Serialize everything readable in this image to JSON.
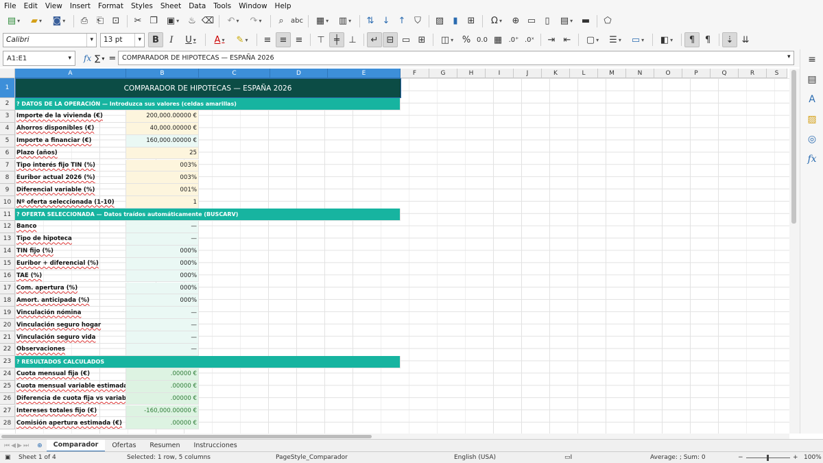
{
  "menu": [
    "File",
    "Edit",
    "View",
    "Insert",
    "Format",
    "Styles",
    "Sheet",
    "Data",
    "Tools",
    "Window",
    "Help"
  ],
  "font": {
    "name": "Calibri",
    "size": "13 pt"
  },
  "formula": {
    "cellref": "A1:E1",
    "content": "COMPARADOR DE HIPOTECAS — ESPAÑA 2026",
    "fx": "fx",
    "sum": "∑",
    "eq": "="
  },
  "columns": [
    "A",
    "B",
    "C",
    "D",
    "E",
    "F",
    "G",
    "H",
    "I",
    "J",
    "K",
    "L",
    "M",
    "N",
    "O",
    "P",
    "Q",
    "R",
    "S"
  ],
  "rows": [
    "1",
    "2",
    "3",
    "4",
    "5",
    "6",
    "7",
    "8",
    "9",
    "10",
    "11",
    "12",
    "13",
    "14",
    "15",
    "16",
    "17",
    "18",
    "19",
    "20",
    "21",
    "22",
    "23",
    "24",
    "25",
    "26",
    "27",
    "28"
  ],
  "sheet": {
    "title": "COMPARADOR DE HIPOTECAS — ESPAÑA 2026",
    "sec1": "? DATOS DE LA OPERACIÓN — Introduzca sus valores (celdas amarillas)",
    "sec2": "? OFERTA SELECCIONADA — Datos traídos automáticamente (BUSCARV)",
    "sec3": "? RESULTADOS CALCULADOS",
    "inputs": [
      {
        "label": "Importe de la vivienda (€)",
        "value": "200,000.00000 €"
      },
      {
        "label": "Ahorros disponibles (€)",
        "value": "40,000.00000 €"
      },
      {
        "label": "Importe a financiar (€)",
        "value": "160,000.00000 €"
      },
      {
        "label": "Plazo (años)",
        "value": "25"
      },
      {
        "label": "Tipo interés fijo TIN (%)",
        "value": "003%"
      },
      {
        "label": "Euribor actual 2026 (%)",
        "value": "003%"
      },
      {
        "label": "Diferencial variable (%)",
        "value": "001%"
      },
      {
        "label": "Nº oferta seleccionada (1-10)",
        "value": "1"
      }
    ],
    "offer": [
      {
        "label": "Banco",
        "value": "—"
      },
      {
        "label": "Tipo de hipoteca",
        "value": "—"
      },
      {
        "label": "TIN fijo (%)",
        "value": "000%"
      },
      {
        "label": "Euribor + diferencial (%)",
        "value": "000%"
      },
      {
        "label": "TAE (%)",
        "value": "000%"
      },
      {
        "label": "Com. apertura (%)",
        "value": "000%"
      },
      {
        "label": "Amort. anticipada (%)",
        "value": "000%"
      },
      {
        "label": "Vinculación nómina",
        "value": "—"
      },
      {
        "label": "Vinculación seguro hogar",
        "value": "—"
      },
      {
        "label": "Vinculación seguro vida",
        "value": "—"
      },
      {
        "label": "Observaciones",
        "value": "—"
      }
    ],
    "results": [
      {
        "label": "Cuota mensual fija (€)",
        "value": ".00000 €"
      },
      {
        "label": "Cuota mensual variable estimada (€)",
        "value": ".00000 €"
      },
      {
        "label": "Diferencia de cuota fija vs variable (€)",
        "value": ".00000 €"
      },
      {
        "label": "Intereses totales fijo (€)",
        "value": "-160,000.00000 €"
      },
      {
        "label": "Comisión apertura estimada (€)",
        "value": ".00000 €"
      }
    ]
  },
  "tabs": {
    "active": "Comparador",
    "items": [
      "Comparador",
      "Ofertas",
      "Resumen",
      "Instrucciones"
    ]
  },
  "status": {
    "sheet": "Sheet 1 of 4",
    "selection": "Selected: 1 row, 5 columns",
    "pagestyle": "PageStyle_Comparador",
    "language": "English (USA)",
    "average": "Average: ; Sum: 0",
    "zoom": "100%"
  },
  "colors": {
    "title_bg": "#0c4c45",
    "section_bg": "#17b4a0",
    "selection": "#3d8fd9",
    "input_bg": "#fdf5dd",
    "output_bg": "#eaf8f4",
    "result_bg": "#ddf3e2"
  }
}
